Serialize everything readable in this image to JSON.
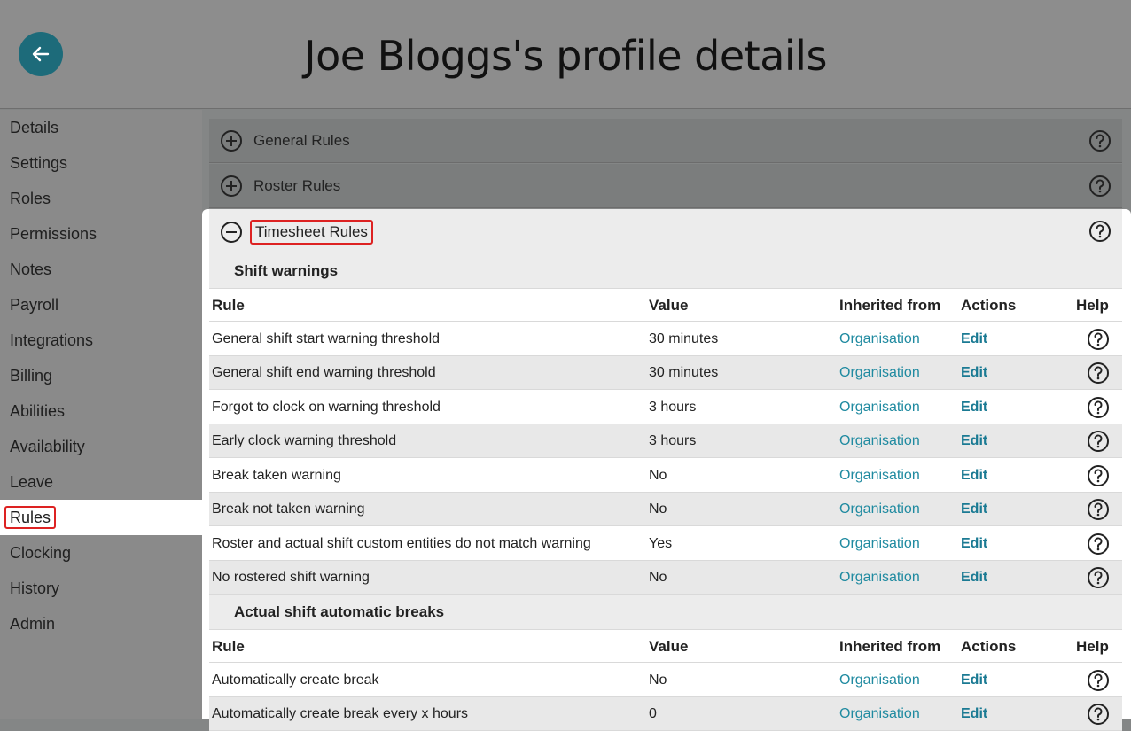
{
  "header": {
    "title": "Joe Bloggs's profile details",
    "back_icon": "arrow-left-icon"
  },
  "sidebar": {
    "items": [
      {
        "label": "Details"
      },
      {
        "label": "Settings"
      },
      {
        "label": "Roles"
      },
      {
        "label": "Permissions"
      },
      {
        "label": "Notes"
      },
      {
        "label": "Payroll"
      },
      {
        "label": "Integrations"
      },
      {
        "label": "Billing"
      },
      {
        "label": "Abilities"
      },
      {
        "label": "Availability"
      },
      {
        "label": "Leave"
      },
      {
        "label": "Rules"
      },
      {
        "label": "Clocking"
      },
      {
        "label": "History"
      },
      {
        "label": "Admin"
      }
    ],
    "active": "Rules"
  },
  "accordions": [
    {
      "label": "General Rules",
      "state": "collapsed"
    },
    {
      "label": "Roster Rules",
      "state": "collapsed"
    },
    {
      "label": "Timesheet Rules",
      "state": "expanded"
    }
  ],
  "columns": {
    "rule": "Rule",
    "value": "Value",
    "inherited": "Inherited from",
    "actions": "Actions",
    "help": "Help"
  },
  "sections": [
    {
      "title": "Shift warnings",
      "rows": [
        {
          "rule": "General shift start warning threshold",
          "value": "30 minutes",
          "inherited": "Organisation",
          "action": "Edit"
        },
        {
          "rule": "General shift end warning threshold",
          "value": "30 minutes",
          "inherited": "Organisation",
          "action": "Edit"
        },
        {
          "rule": "Forgot to clock on warning threshold",
          "value": "3 hours",
          "inherited": "Organisation",
          "action": "Edit"
        },
        {
          "rule": "Early clock warning threshold",
          "value": "3 hours",
          "inherited": "Organisation",
          "action": "Edit"
        },
        {
          "rule": "Break taken warning",
          "value": "No",
          "inherited": "Organisation",
          "action": "Edit"
        },
        {
          "rule": "Break not taken warning",
          "value": "No",
          "inherited": "Organisation",
          "action": "Edit"
        },
        {
          "rule": "Roster and actual shift custom entities do not match warning",
          "value": "Yes",
          "inherited": "Organisation",
          "action": "Edit"
        },
        {
          "rule": "No rostered shift warning",
          "value": "No",
          "inherited": "Organisation",
          "action": "Edit"
        }
      ]
    },
    {
      "title": "Actual shift automatic breaks",
      "rows": [
        {
          "rule": "Automatically create break",
          "value": "No",
          "inherited": "Organisation",
          "action": "Edit"
        },
        {
          "rule": "Automatically create break every x hours",
          "value": "0",
          "inherited": "Organisation",
          "action": "Edit"
        }
      ]
    }
  ],
  "colors": {
    "accent": "#1f8aa0",
    "highlight": "#dd2222",
    "back_button": "#1d6b7a"
  }
}
